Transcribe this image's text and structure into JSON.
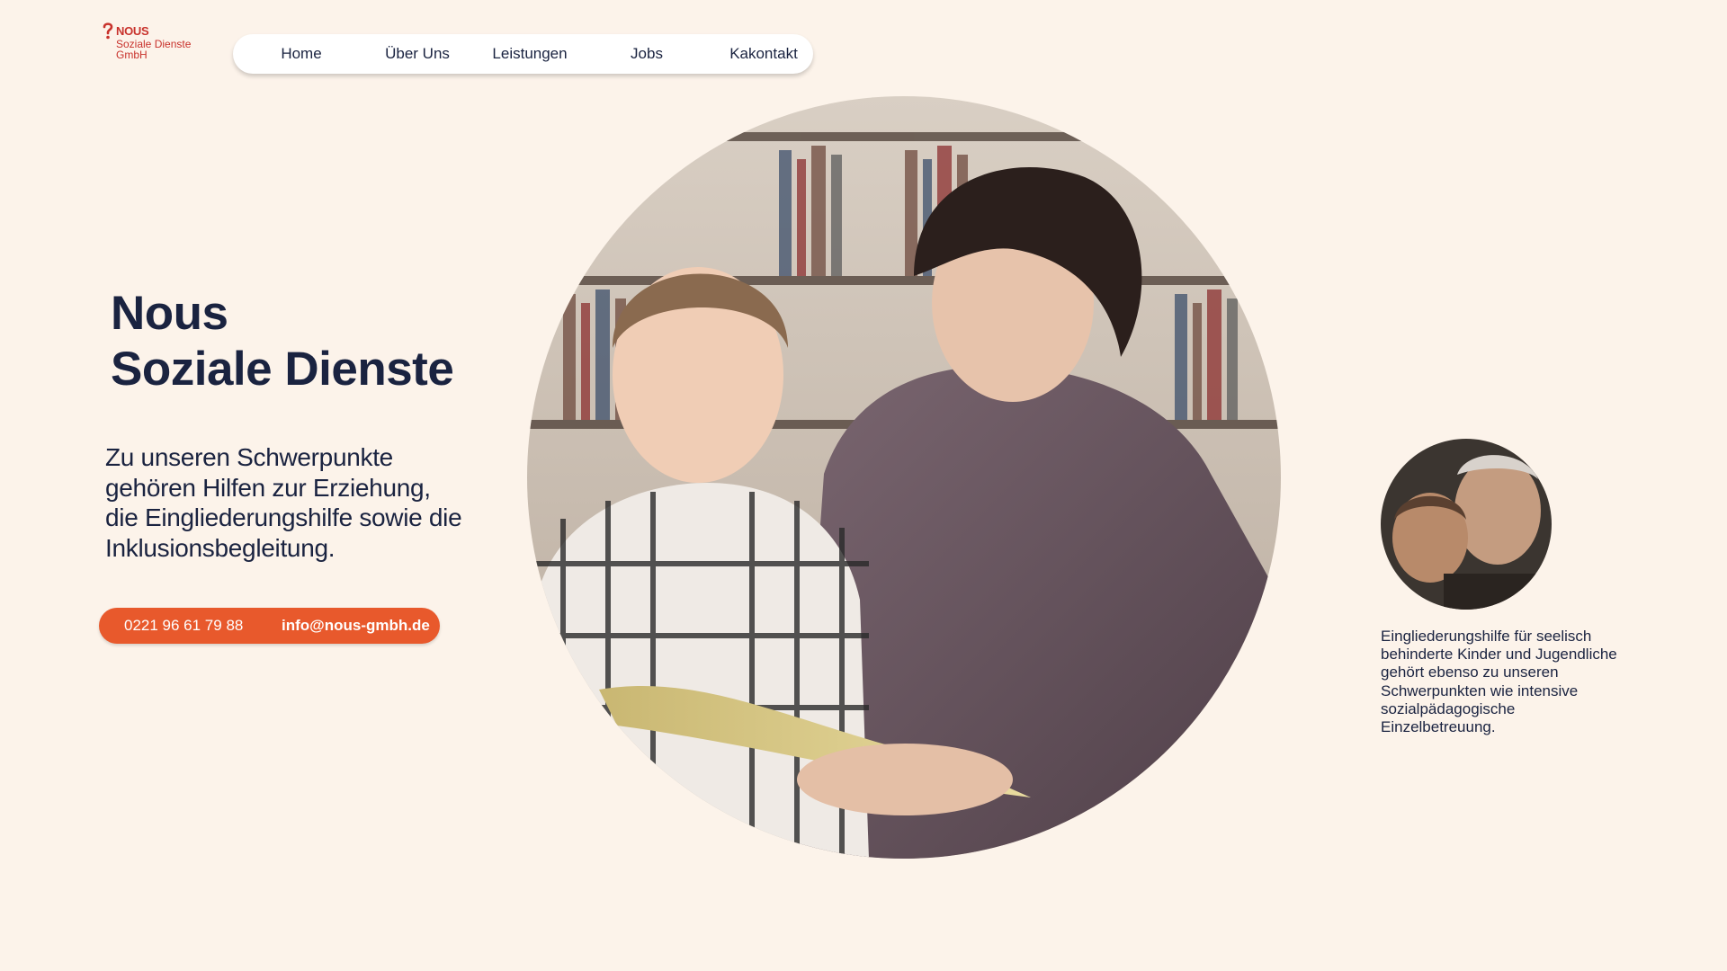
{
  "logo": {
    "brand": "NOUS",
    "line1": "Soziale Dienste",
    "line2": "GmbH",
    "color": "#c8322c"
  },
  "nav": {
    "items": [
      "Home",
      "Über Uns",
      "Leistungen",
      "Jobs",
      "Kakontakt"
    ]
  },
  "hero": {
    "title_line1": "Nous",
    "title_line2": "Soziale Dienste",
    "text": "Zu unseren Schwerpunkte gehören Hilfen zur Erziehung, die Eingliederungshilfe sowie die Inklusionsbegleitung."
  },
  "contact": {
    "phone": "0221 96 61 79 88",
    "email": "info@nous-gmbh.de",
    "accent": "#e8592c"
  },
  "images": {
    "main": "photo-woman-reading-with-boy",
    "secondary": "photo-grandfather-with-child"
  },
  "side": {
    "text": "Eingliederungshilfe für seelisch behinderte Kinder und Jugendliche gehört ebenso zu unseren Schwerpunkten wie intensive sozialpädagogische Einzelbetreuung."
  },
  "colors": {
    "background": "#fcf3ea",
    "text": "#1a2340"
  }
}
